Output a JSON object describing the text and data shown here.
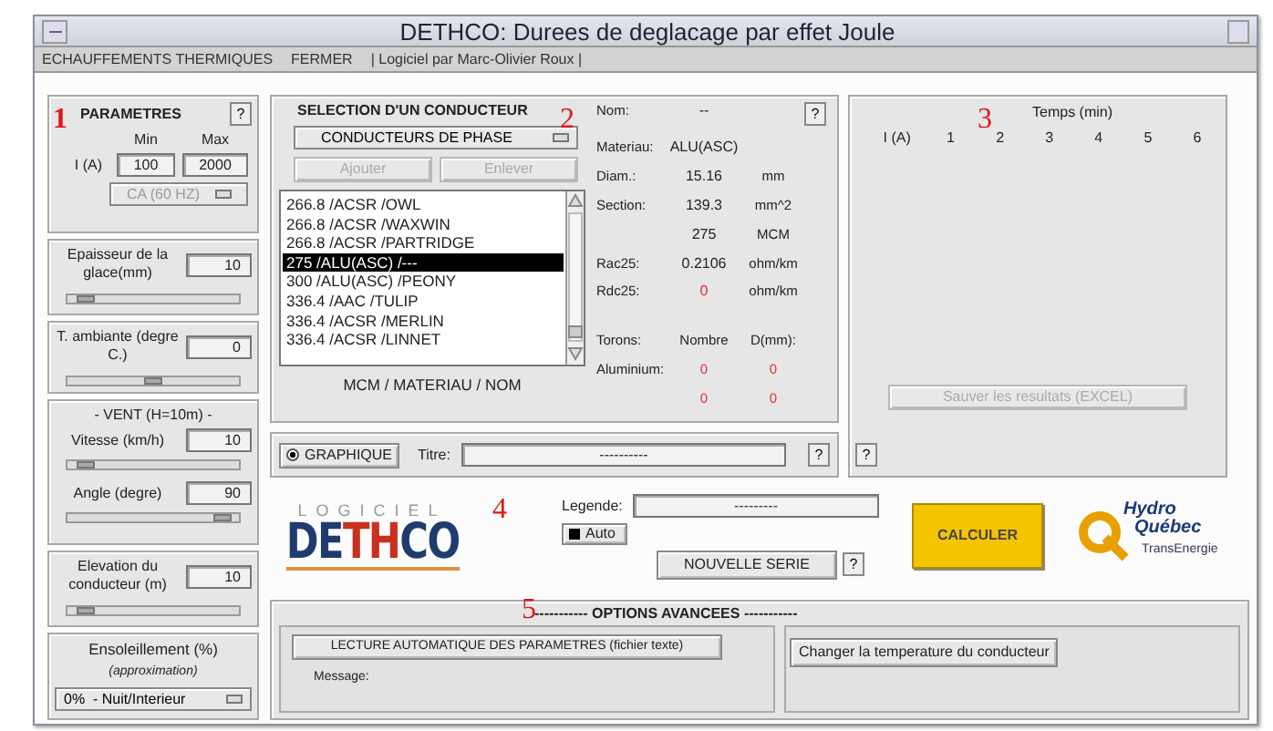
{
  "window": {
    "title": "DETHCO: Durees de deglacage par effet Joule"
  },
  "menu": [
    {
      "label": "ECHAUFFEMENTS THERMIQUES"
    },
    {
      "label": "FERMER"
    },
    {
      "label": "| Logiciel par Marc-Olivier Roux |"
    }
  ],
  "annotations": [
    "1",
    "2",
    "3",
    "4",
    "5"
  ],
  "parameters": {
    "title": "PARAMETRES",
    "help": "?",
    "current_label": "I (A)",
    "min_label": "Min",
    "max_label": "Max",
    "min": "100",
    "max": "2000",
    "mode": "CA (60 HZ)"
  },
  "sections": [
    {
      "kind": "slider",
      "label": "Epaisseur de la glace(mm)",
      "value": "10",
      "level": 0.06
    },
    {
      "kind": "slider",
      "label": "T. ambiante (degre C.)",
      "value": "0",
      "level": 0.5
    },
    {
      "kind": "group",
      "title": "- VENT (H=10m) -",
      "items": [
        {
          "label": "Vitesse (km/h)",
          "value": "10",
          "level": 0.06
        },
        {
          "label": "Angle (degre)",
          "value": "90",
          "level": 0.95
        }
      ]
    },
    {
      "kind": "slider",
      "label": "Elevation du conducteur (m)",
      "value": "10",
      "level": 0.06
    },
    {
      "kind": "dropdown",
      "label": "Ensoleillement (%)",
      "note": "(approximation)",
      "value": "0%  - Nuit/Interieur"
    }
  ],
  "conductor": {
    "title": "SELECTION D'UN CONDUCTEUR",
    "category": "CONDUCTEURS DE PHASE",
    "buttons": [
      {
        "label": "Ajouter",
        "disabled": true
      },
      {
        "label": "Enlever",
        "disabled": true
      }
    ],
    "list": [
      {
        "label": "266.8 /ACSR /OWL",
        "selected": false
      },
      {
        "label": "266.8 /ACSR /WAXWIN",
        "selected": false
      },
      {
        "label": "266.8 /ACSR /PARTRIDGE",
        "selected": false
      },
      {
        "label": "275 /ALU(ASC) /---",
        "selected": true
      },
      {
        "label": "300 /ALU(ASC) /PEONY",
        "selected": false
      },
      {
        "label": "336.4 /AAC /TULIP",
        "selected": false
      },
      {
        "label": "336.4 /ACSR /MERLIN",
        "selected": false
      },
      {
        "label": "336.4 /ACSR /LINNET",
        "selected": false
      }
    ],
    "list_caption": "MCM / MATERIAU / NOM",
    "help": "?",
    "details": [
      {
        "label": "Nom:",
        "value": "--",
        "alert": false
      },
      {
        "label": "Materiau:",
        "value": "ALU(ASC)",
        "alert": false
      },
      {
        "label": "Diam.:",
        "value": "15.16",
        "unit": "mm",
        "alert": false
      },
      {
        "label": "Section:",
        "value": "139.3",
        "unit": "mm^2",
        "alert": false
      },
      {
        "value": "275",
        "unit": "MCM",
        "alert": false
      },
      {
        "label": "Rac25:",
        "value": "0.2106",
        "unit": "ohm/km",
        "alert": false
      },
      {
        "label": "Rdc25:",
        "value": "0",
        "unit": "ohm/km",
        "alert": true
      }
    ],
    "strands": {
      "headers": [
        "Torons:",
        "Nombre",
        "D(mm):"
      ],
      "rows": [
        {
          "label": "Aluminium:",
          "values": [
            "0",
            "0"
          ]
        },
        {
          "values": [
            "0",
            "0"
          ]
        }
      ]
    }
  },
  "results": {
    "time_header": "Temps (min)",
    "columns": [
      "I (A)",
      "1",
      "2",
      "3",
      "4",
      "5",
      "6"
    ],
    "save_button": {
      "label": "Sauver les resultats (EXCEL)",
      "disabled": true
    },
    "help": "?"
  },
  "graph": {
    "label": "GRAPHIQUE",
    "checked": true,
    "title_label": "Titre:",
    "title_value": "----------",
    "help": "?"
  },
  "logo": {
    "top": "LOGICIEL",
    "name_start": "DE",
    "name_mid": "TH",
    "name_end": "CO"
  },
  "legend": {
    "label": "Legende:",
    "value": "---------",
    "auto_label": "Auto",
    "auto_checked": true,
    "new_series": "NOUVELLE SERIE",
    "help": "?"
  },
  "calculate": "CALCULER",
  "partner": {
    "line1": "Hydro",
    "line2": "Québec",
    "sub": "TransEnergie"
  },
  "options": {
    "title": "----------- OPTIONS AVANCEES -----------",
    "read_button": "LECTURE AUTOMATIQUE DES PARAMETRES (fichier texte)",
    "message_label": "Message:",
    "temp_button": "Changer la temperature du conducteur"
  }
}
